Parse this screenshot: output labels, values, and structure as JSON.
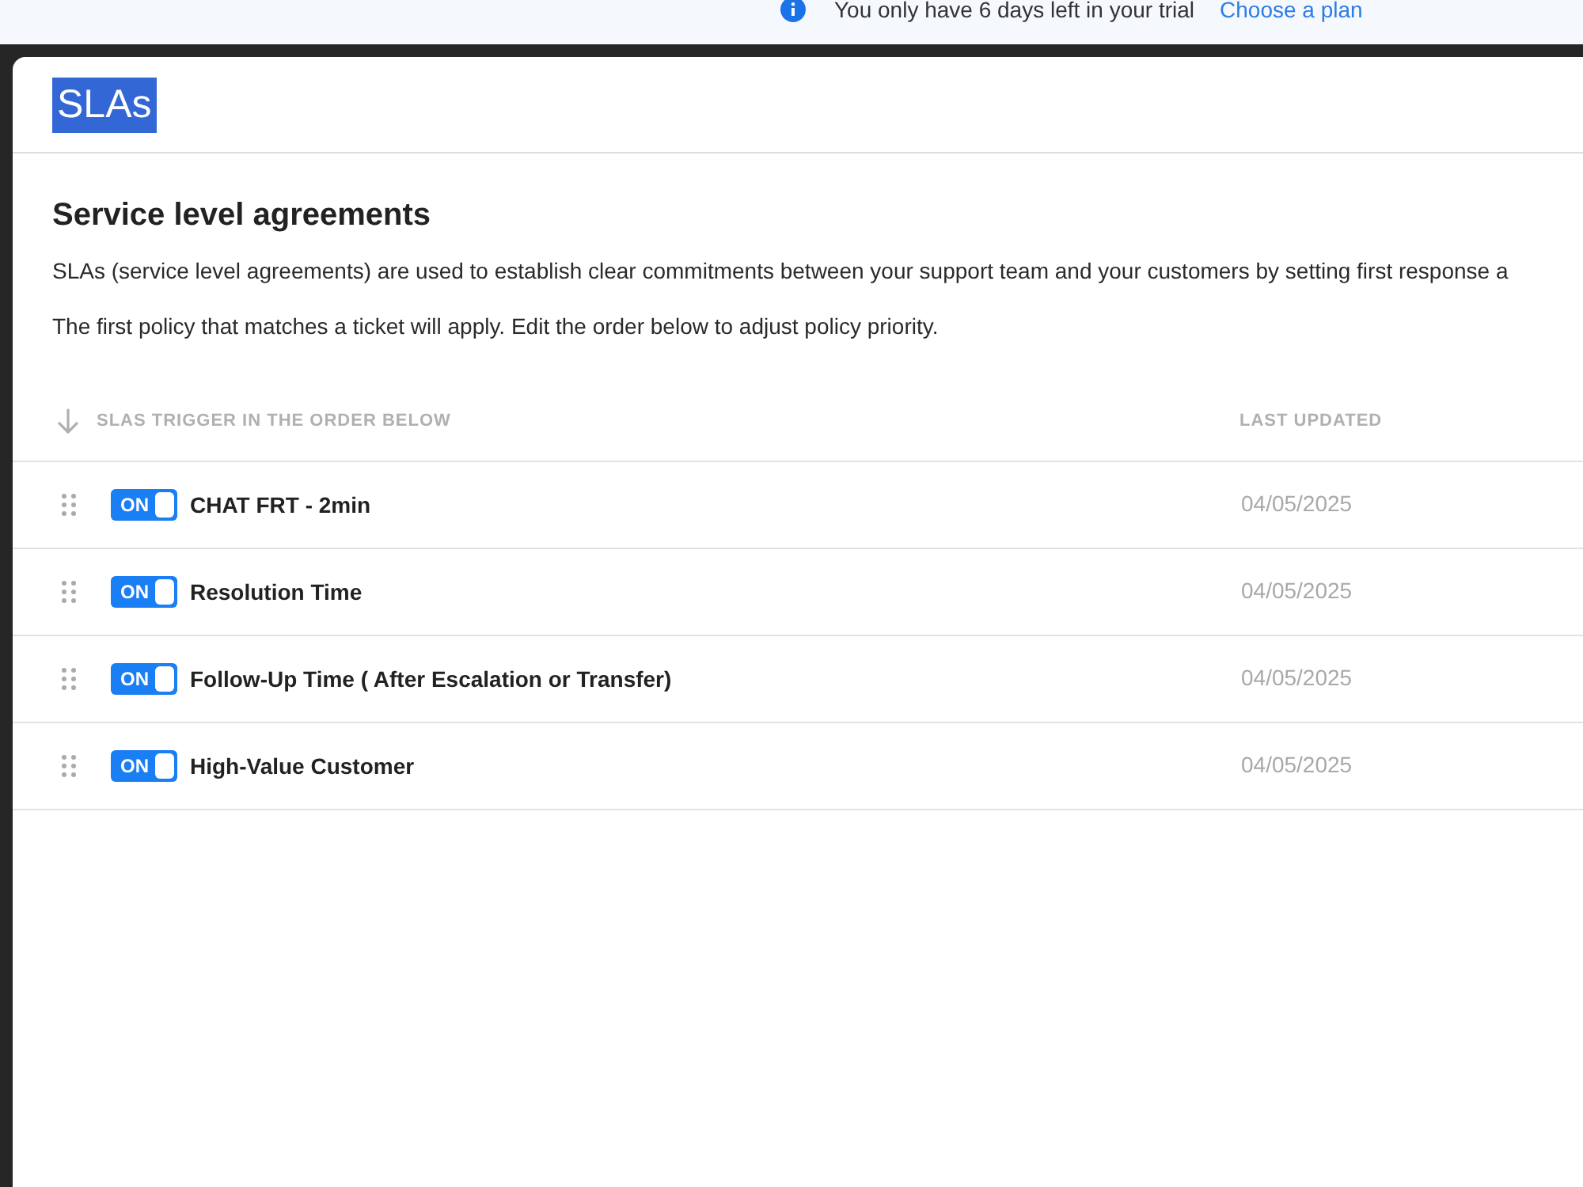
{
  "banner": {
    "message": "You only have 6 days left in your trial",
    "link": "Choose a plan"
  },
  "page": {
    "title": "SLAs",
    "highlighted": true
  },
  "section": {
    "title": "Service level agreements",
    "paragraphs": [
      "SLAs (service level agreements) are used to establish clear commitments between your support team and your customers by setting first response a",
      "The first policy that matches a ticket will apply. Edit the order below to adjust policy priority."
    ]
  },
  "table": {
    "columns": [
      {
        "label": "SLAS TRIGGER IN THE ORDER BELOW"
      },
      {
        "label": "LAST UPDATED"
      }
    ],
    "rows": [
      {
        "on": true,
        "toggle_label": "ON",
        "name": "CHAT FRT - 2min",
        "last_updated": "04/05/2025"
      },
      {
        "on": true,
        "toggle_label": "ON",
        "name": "Resolution Time",
        "last_updated": "04/05/2025"
      },
      {
        "on": true,
        "toggle_label": "ON",
        "name": "Follow-Up Time ( After Escalation or Transfer)",
        "last_updated": "04/05/2025"
      },
      {
        "on": true,
        "toggle_label": "ON",
        "name": "High-Value Customer",
        "last_updated": "04/05/2025"
      }
    ]
  }
}
